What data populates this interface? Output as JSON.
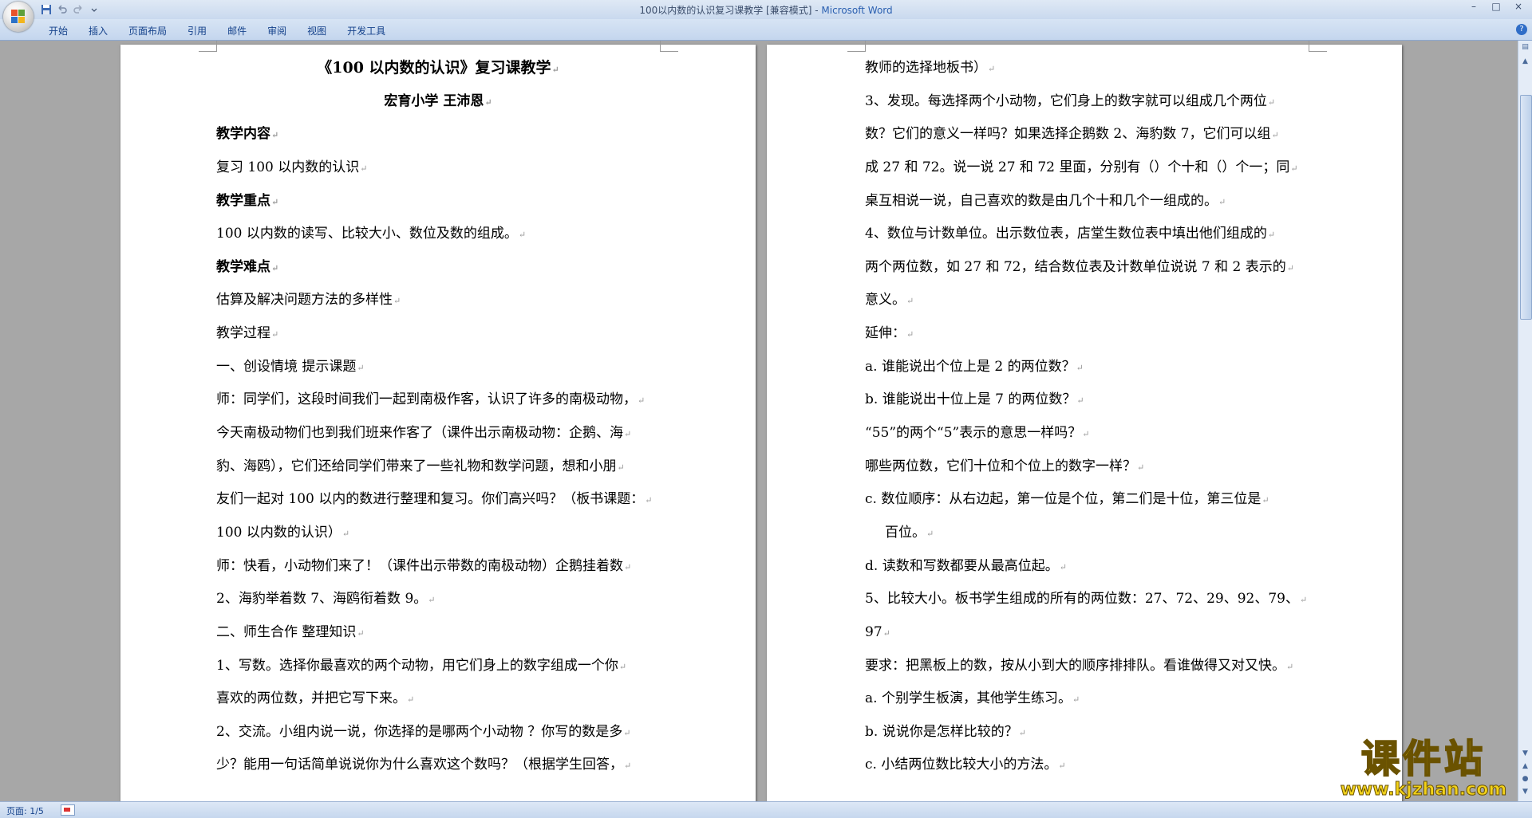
{
  "window": {
    "doc_title": "100以内数的认识复习课教学 [兼容模式] - ",
    "app_name": "Microsoft Word",
    "minimize": "–",
    "maximize": "□",
    "close": "×"
  },
  "quick_access": {
    "save_icon": "floppy-disk-icon",
    "undo_icon": "undo-icon",
    "redo_icon": "redo-icon",
    "customize_icon": "chevron-down-icon"
  },
  "ribbon": {
    "tabs": [
      "开始",
      "插入",
      "页面布局",
      "引用",
      "邮件",
      "审阅",
      "视图",
      "开发工具"
    ],
    "help": "?"
  },
  "page_left": {
    "lines": [
      {
        "text": "《100 以内数的认识》复习课教学",
        "style": "title center"
      },
      {
        "text": "宏育小学    王沛恩",
        "style": "bold center"
      },
      {
        "text": "教学内容",
        "style": "bold"
      },
      {
        "text": "复习 100 以内数的认识",
        "style": ""
      },
      {
        "text": "教学重点",
        "style": "bold"
      },
      {
        "text": "100 以内数的读写、比较大小、数位及数的组成。",
        "style": ""
      },
      {
        "text": "教学难点",
        "style": "bold"
      },
      {
        "text": "估算及解决问题方法的多样性",
        "style": ""
      },
      {
        "text": "教学过程",
        "style": ""
      },
      {
        "text": "一、创设情境   提示课题",
        "style": ""
      },
      {
        "text": "师：同学们，这段时间我们一起到南极作客，认识了许多的南极动物，",
        "style": ""
      },
      {
        "text": "今天南极动物们也到我们班来作客了（课件出示南极动物：企鹅、海",
        "style": ""
      },
      {
        "text": "豹、海鸥），它们还给同学们带来了一些礼物和数学问题，想和小朋",
        "style": ""
      },
      {
        "text": "友们一起对 100 以内的数进行整理和复习。你们高兴吗？（板书课题：",
        "style": ""
      },
      {
        "text": "100 以内数的认识）",
        "style": ""
      },
      {
        "text": "师：快看，小动物们来了！（课件出示带数的南极动物）企鹅挂着数",
        "style": ""
      },
      {
        "text": "2、海豹举着数 7、海鸥衔着数 9。",
        "style": ""
      },
      {
        "text": "二、师生合作   整理知识",
        "style": ""
      },
      {
        "text": "1、写数。选择你最喜欢的两个动物，用它们身上的数字组成一个你",
        "style": ""
      },
      {
        "text": "喜欢的两位数，并把它写下来。",
        "style": ""
      },
      {
        "text": "2、交流。小组内说一说，你选择的是哪两个小动物 ？你写的数是多",
        "style": ""
      },
      {
        "text": "少？能用一句话简单说说你为什么喜欢这个数吗？（根据学生回答，",
        "style": ""
      }
    ]
  },
  "page_right": {
    "lines": [
      {
        "text": "教师的选择地板书）",
        "style": ""
      },
      {
        "text": "3、发现。每选择两个小动物，它们身上的数字就可以组成几个两位",
        "style": ""
      },
      {
        "text": "数？它们的意义一样吗？如果选择企鹅数 2、海豹数 7，它们可以组",
        "style": ""
      },
      {
        "text": "成 27 和 72。说一说 27 和 72 里面，分别有（）个十和（）个一；同",
        "style": ""
      },
      {
        "text": "桌互相说一说，自己喜欢的数是由几个十和几个一组成的。",
        "style": ""
      },
      {
        "text": "4、数位与计数单位。出示数位表，店堂生数位表中填出他们组成的",
        "style": ""
      },
      {
        "text": "两个两位数，如 27 和 72，结合数位表及计数单位说说 7 和 2 表示的",
        "style": ""
      },
      {
        "text": "意义。",
        "style": ""
      },
      {
        "text": "延伸：",
        "style": ""
      },
      {
        "text": "a. 谁能说出个位上是 2 的两位数？",
        "style": ""
      },
      {
        "text": "b. 谁能说出十位上是 7 的两位数？",
        "style": ""
      },
      {
        "text": "“55”的两个“5”表示的意思一样吗？",
        "style": ""
      },
      {
        "text": "哪些两位数，它们十位和个位上的数字一样？",
        "style": ""
      },
      {
        "text": "c. 数位顺序：从右边起，第一位是个位，第二们是十位，第三位是",
        "style": ""
      },
      {
        "text": "百位。",
        "style": "indent"
      },
      {
        "text": "d. 读数和写数都要从最高位起。",
        "style": ""
      },
      {
        "text": "5、比较大小。板书学生组成的所有的两位数：27、72、29、92、79、",
        "style": ""
      },
      {
        "text": "97",
        "style": ""
      },
      {
        "text": "要求：把黑板上的数，按从小到大的顺序排排队。看谁做得又对又快。",
        "style": ""
      },
      {
        "text": "a. 个别学生板演，其他学生练习。",
        "style": ""
      },
      {
        "text": "b. 说说你是怎样比较的？",
        "style": ""
      },
      {
        "text": "c. 小结两位数比较大小的方法。",
        "style": ""
      }
    ]
  },
  "status": {
    "page_info": "页面: 1/5"
  },
  "watermark": {
    "name": "课件站",
    "url": "www.kjzhan.com"
  },
  "colors": {
    "ribbon_blue": "#c4d6ee",
    "accent_text": "#15428b",
    "watermark_yellow": "#f2d21a"
  }
}
